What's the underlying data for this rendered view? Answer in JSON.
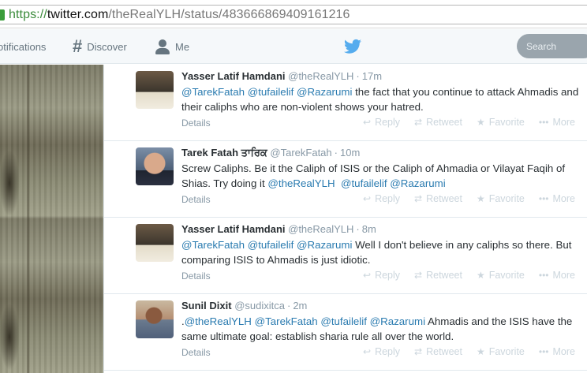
{
  "browser": {
    "url_scheme": "https://",
    "url_host": "twitter.com",
    "url_path": "/theRealYLH/status/483666869409161216"
  },
  "nav": {
    "notifications_label": "otifications",
    "discover_label": "Discover",
    "me_label": "Me",
    "search_placeholder": "Search"
  },
  "icons": {
    "discover": "hash-icon",
    "me": "person-icon",
    "brand": "twitter-bird-icon",
    "reply": "reply-icon",
    "retweet": "retweet-icon",
    "favorite": "star-icon",
    "more": "ellipsis-icon"
  },
  "colors": {
    "mention": "#2a7bb0",
    "muted": "#8899a6",
    "brand": "#55acee"
  },
  "actions": {
    "reply": "Reply",
    "retweet": "Retweet",
    "favorite": "Favorite",
    "more": "More",
    "details": "Details"
  },
  "tweets": [
    {
      "name": "Yasser Latif Hamdani",
      "handle": "@theRealYLH",
      "time": "17m",
      "segments": [
        {
          "t": "@TarekFatah",
          "m": true
        },
        {
          "t": " ",
          "m": false
        },
        {
          "t": "@tufailelif",
          "m": true
        },
        {
          "t": " ",
          "m": false
        },
        {
          "t": "@Razarumi",
          "m": true
        },
        {
          "t": " the fact that you continue to attack Ahmadis and their caliphs who are non-violent shows your hatred.",
          "m": false
        }
      ]
    },
    {
      "name": "Tarek Fatah ਤਾਰਿਕ",
      "handle": "@TarekFatah",
      "time": "10m",
      "segments": [
        {
          "t": "Screw Caliphs. Be it the Caliph of ISIS or the Caliph of Ahmadia or Vilayat Faqih of Shias. Try doing it ",
          "m": false
        },
        {
          "t": "@theRealYLH",
          "m": true
        },
        {
          "t": "  ",
          "m": false
        },
        {
          "t": "@tufailelif",
          "m": true
        },
        {
          "t": " ",
          "m": false
        },
        {
          "t": "@Razarumi",
          "m": true
        }
      ]
    },
    {
      "name": "Yasser Latif Hamdani",
      "handle": "@theRealYLH",
      "time": "8m",
      "segments": [
        {
          "t": "@TarekFatah",
          "m": true
        },
        {
          "t": " ",
          "m": false
        },
        {
          "t": "@tufailelif",
          "m": true
        },
        {
          "t": " ",
          "m": false
        },
        {
          "t": "@Razarumi",
          "m": true
        },
        {
          "t": " Well I don't believe in any caliphs so there. But comparing ISIS to Ahmadis is just idiotic.",
          "m": false
        }
      ]
    },
    {
      "name": "Sunil Dixit",
      "handle": "@sudixitca",
      "time": "2m",
      "segments": [
        {
          "t": ".",
          "m": false
        },
        {
          "t": "@theRealYLH",
          "m": true
        },
        {
          "t": " ",
          "m": false
        },
        {
          "t": "@TarekFatah",
          "m": true
        },
        {
          "t": " ",
          "m": false
        },
        {
          "t": "@tufailelif",
          "m": true
        },
        {
          "t": " ",
          "m": false
        },
        {
          "t": "@Razarumi",
          "m": true
        },
        {
          "t": " Ahmadis and the ISIS have the same ultimate goal: establish sharia rule all over the world.",
          "m": false
        }
      ]
    }
  ]
}
